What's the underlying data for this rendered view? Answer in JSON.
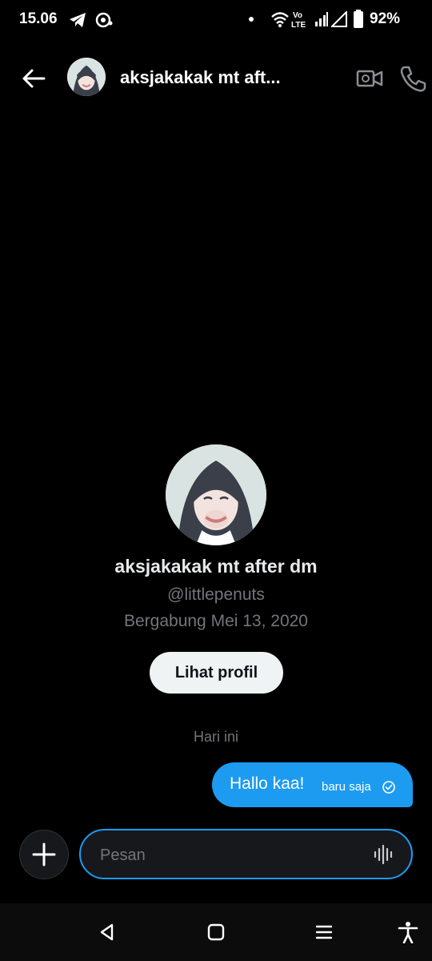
{
  "status_bar": {
    "time": "15.06",
    "battery": "92%",
    "icons": [
      "telegram-icon",
      "notification-icon",
      "dot-icon",
      "wifi-icon",
      "volte-icon",
      "signal-icon",
      "signal-icon",
      "battery-icon"
    ]
  },
  "header": {
    "title": "aksjakakak mt aft..."
  },
  "profile": {
    "name": "aksjakakak mt after dm",
    "handle": "@littlepenuts",
    "joined": "Bergabung Mei 13, 2020",
    "view_profile_label": "Lihat profil"
  },
  "conversation": {
    "date_label": "Hari ini",
    "messages": [
      {
        "text": "Hallo kaa!",
        "time": "baru saja",
        "status_icon": "check-circle-icon",
        "color": "#1d9bf0"
      }
    ]
  },
  "composer": {
    "placeholder": "Pesan"
  },
  "colors": {
    "accent": "#1d9bf0",
    "background": "#000000",
    "muted_text": "#71767b"
  }
}
